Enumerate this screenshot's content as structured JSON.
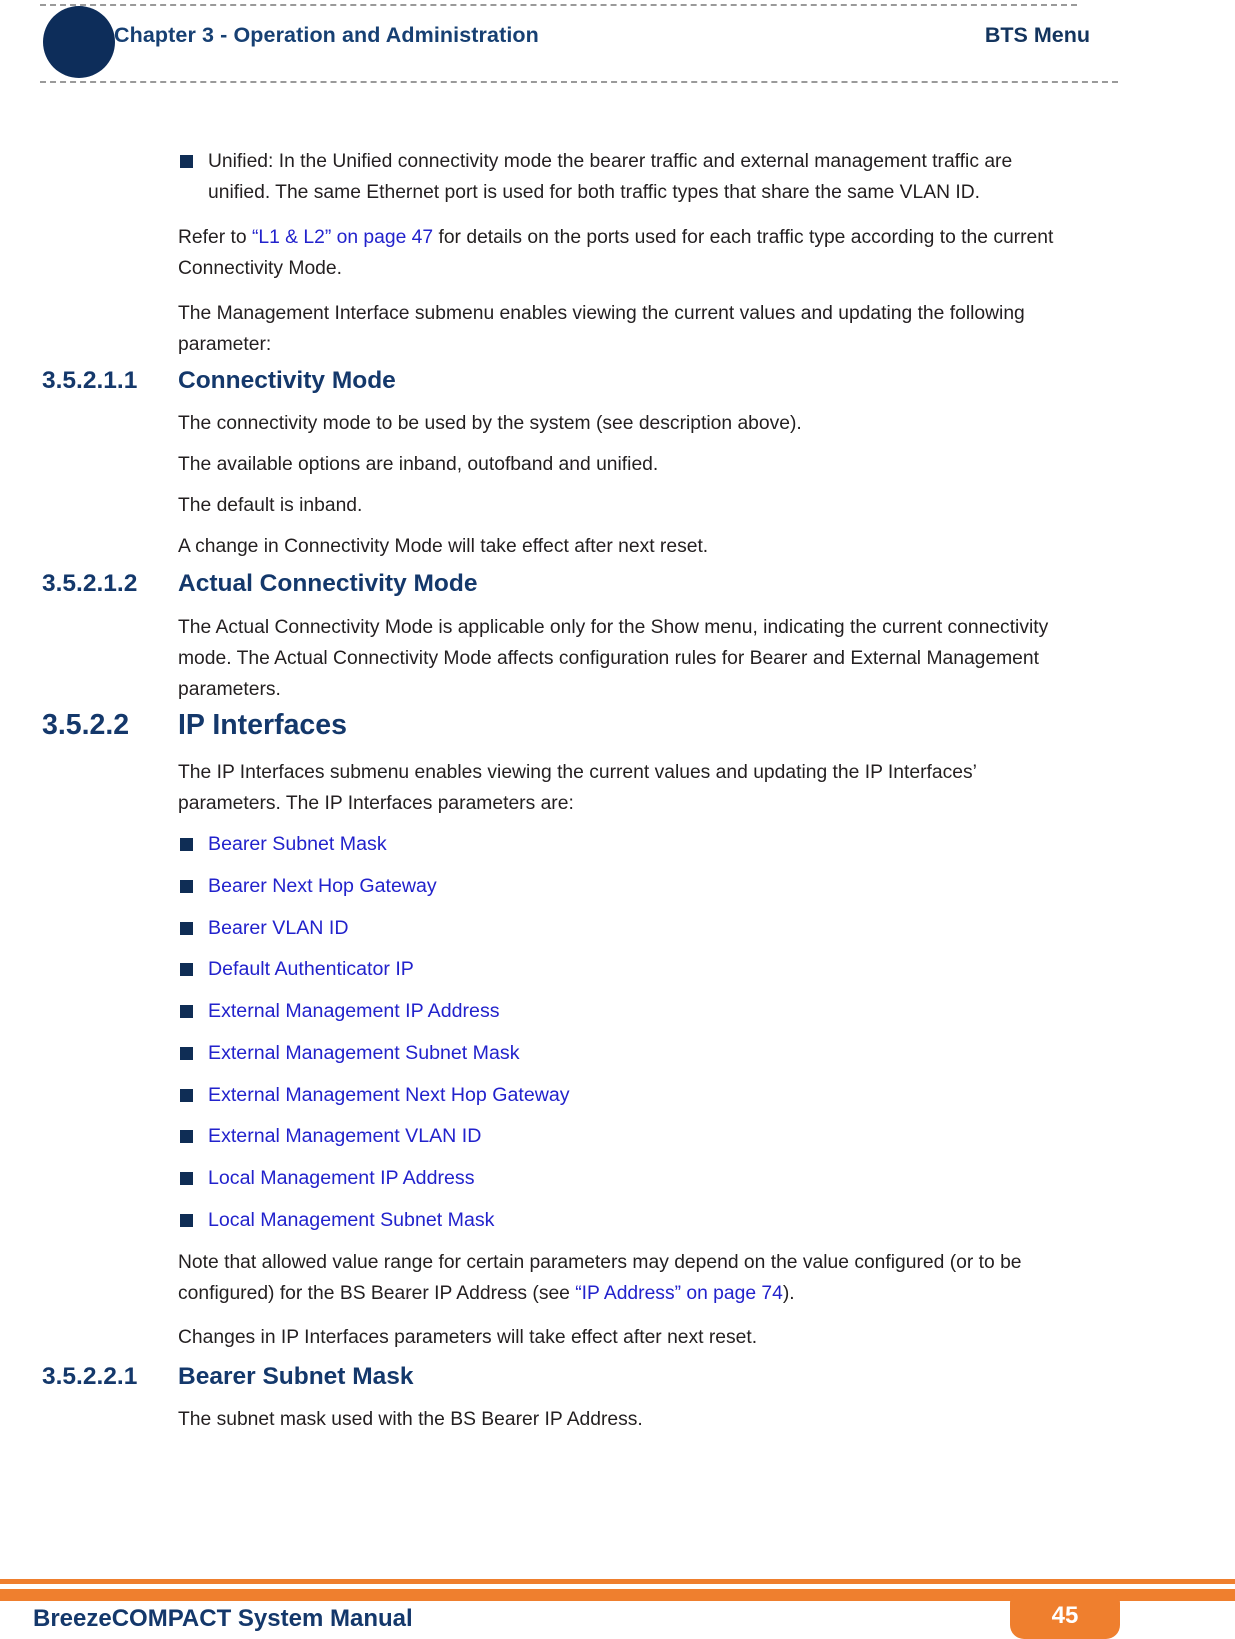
{
  "header": {
    "chapter": "Chapter 3 - Operation and Administration",
    "section": "BTS Menu"
  },
  "colors": {
    "navy": "#14386b",
    "dark_navy_circle": "#0d2d5a",
    "link_blue": "#2222cc",
    "orange": "#ef7f2e",
    "body_text": "#231f20"
  },
  "content": {
    "unified_bullet": {
      "line1": "Unified: In the Unified connectivity mode the bearer traffic and external management traffic are",
      "line2": "unified. The same Ethernet port is used for both traffic types that share the same VLAN ID."
    },
    "refer_paragraph": {
      "prefix": "Refer to ",
      "link": "“L1 & L2” on page 47",
      "suffix": " for details on the ports used for each traffic type according to the current",
      "line2": "Connectivity Mode."
    },
    "mgmt_paragraph": {
      "line1": "The Management Interface submenu enables viewing the current values and updating the following",
      "line2": "parameter:"
    },
    "sections": [
      {
        "number": "3.5.2.1.1",
        "title": "Connectivity Mode",
        "level": "h4",
        "paragraphs": [
          "The connectivity mode to be used by the system (see description above).",
          "The available options are inband, outofband and unified.",
          "The default is inband.",
          "A change in Connectivity Mode will take effect after next reset."
        ]
      },
      {
        "number": "3.5.2.1.2",
        "title": "Actual Connectivity Mode",
        "level": "h4",
        "paragraphs": [
          "The Actual Connectivity Mode is applicable only for the Show menu, indicating the current connectivity",
          "mode. The Actual Connectivity Mode affects configuration rules for Bearer and External Management",
          "parameters."
        ]
      },
      {
        "number": "3.5.2.2",
        "title": "IP Interfaces",
        "level": "h3",
        "paragraphs": [
          "The IP Interfaces submenu enables viewing the current values and updating the IP Interfaces’",
          "parameters. The IP Interfaces parameters are:"
        ]
      },
      {
        "number": "3.5.2.2.1",
        "title": "Bearer Subnet Mask",
        "level": "h4",
        "paragraphs": [
          "The subnet mask used with the BS Bearer IP Address."
        ]
      }
    ],
    "ip_interfaces_links": [
      "Bearer Subnet Mask",
      "Bearer Next Hop Gateway",
      "Bearer VLAN ID",
      "Default Authenticator IP",
      "External Management IP Address",
      "External Management Subnet Mask",
      "External Management Next Hop Gateway",
      "External Management VLAN ID",
      "Local Management IP Address",
      "Local Management Subnet Mask"
    ],
    "note_paragraph": {
      "line1": "Note that allowed value range for certain parameters may depend on the value configured (or to be",
      "line2_prefix": "configured) for the BS Bearer IP Address (see ",
      "line2_link": "“IP Address” on page 74",
      "line2_suffix": ")."
    },
    "changes_paragraph": "Changes in IP Interfaces parameters will take effect after next reset."
  },
  "footer": {
    "title": "BreezeCOMPACT System Manual",
    "page_number": "45"
  }
}
